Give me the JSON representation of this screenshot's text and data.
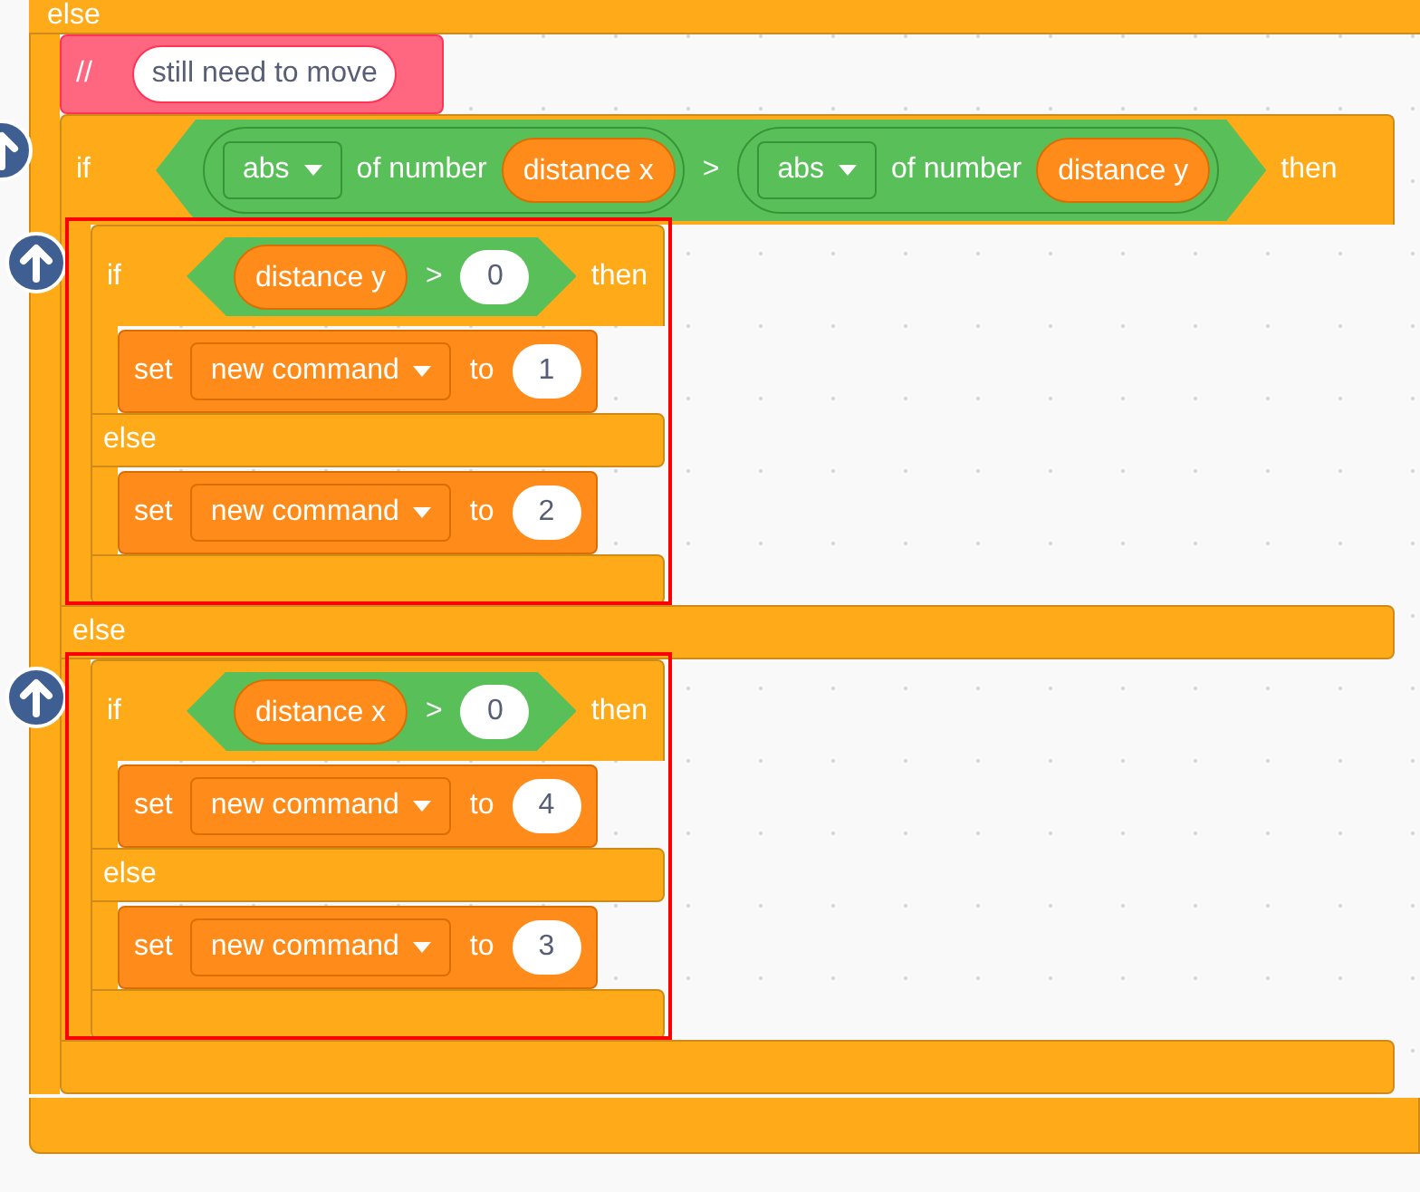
{
  "top_label": "else",
  "blocks": [
    {
      "kind": "comment",
      "symbol": "//",
      "text": "still need to move"
    },
    {
      "kind": "if_else",
      "keyword": "if",
      "then": "then",
      "else": "else",
      "highlighted": false,
      "arrow_button": true,
      "condition": {
        "op": ">",
        "left": {
          "kind": "math",
          "function": "abs",
          "of": "of number",
          "arg": {
            "kind": "variable",
            "name": "distance x"
          }
        },
        "right": {
          "kind": "math",
          "function": "abs",
          "of": "of number",
          "arg": {
            "kind": "variable",
            "name": "distance y"
          }
        }
      },
      "then_blocks": [
        {
          "kind": "if_else",
          "keyword": "if",
          "then": "then",
          "else": "else",
          "highlighted": true,
          "arrow_button": true,
          "condition": {
            "op": ">",
            "left": {
              "kind": "variable",
              "name": "distance y"
            },
            "right": {
              "kind": "number",
              "value": "0"
            }
          },
          "then_blocks": [
            {
              "kind": "set",
              "keyword": "set",
              "variable": "new command",
              "to": "to",
              "value": "1"
            }
          ],
          "else_blocks": [
            {
              "kind": "set",
              "keyword": "set",
              "variable": "new command",
              "to": "to",
              "value": "2"
            }
          ]
        }
      ],
      "else_blocks": [
        {
          "kind": "if_else",
          "keyword": "if",
          "then": "then",
          "else": "else",
          "highlighted": true,
          "arrow_button": true,
          "condition": {
            "op": ">",
            "left": {
              "kind": "variable",
              "name": "distance x"
            },
            "right": {
              "kind": "number",
              "value": "0"
            }
          },
          "then_blocks": [
            {
              "kind": "set",
              "keyword": "set",
              "variable": "new command",
              "to": "to",
              "value": "4"
            }
          ],
          "else_blocks": [
            {
              "kind": "set",
              "keyword": "set",
              "variable": "new command",
              "to": "to",
              "value": "3"
            }
          ]
        }
      ]
    }
  ]
}
